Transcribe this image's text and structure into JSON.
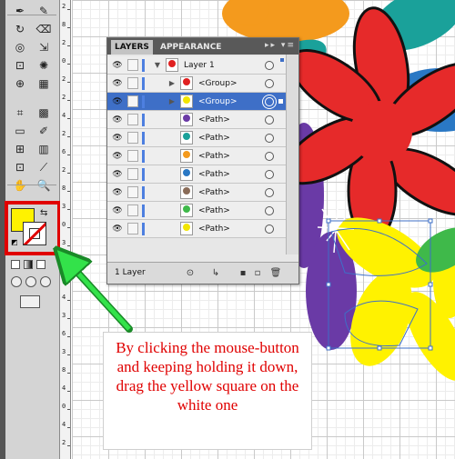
{
  "toolbox": {
    "tools": [
      {
        "name": "pen-icon",
        "glyph": "✒"
      },
      {
        "name": "pencil-icon",
        "glyph": "✎"
      },
      {
        "name": "rotate-icon",
        "glyph": "↻"
      },
      {
        "name": "eraser-icon",
        "glyph": "⌫"
      },
      {
        "name": "warp-icon",
        "glyph": "◎"
      },
      {
        "name": "scale-icon",
        "glyph": "⇲"
      },
      {
        "name": "free-transform-icon",
        "glyph": "⊡"
      },
      {
        "name": "symbol-sprayer-icon",
        "glyph": "✺"
      },
      {
        "name": "shape-builder-icon",
        "glyph": "⊕"
      },
      {
        "name": "live-paint-icon",
        "glyph": "▦"
      },
      {
        "name": "perspective-grid-icon",
        "glyph": "⌗"
      },
      {
        "name": "mesh-icon",
        "glyph": "▩"
      },
      {
        "name": "gradient-icon",
        "glyph": "▭"
      },
      {
        "name": "eyedropper-icon",
        "glyph": "✐"
      },
      {
        "name": "blend-icon",
        "glyph": "⊞"
      },
      {
        "name": "column-graph-icon",
        "glyph": "▥"
      },
      {
        "name": "artboard-icon",
        "glyph": "⊡"
      },
      {
        "name": "slice-icon",
        "glyph": "⟋"
      },
      {
        "name": "hand-icon",
        "glyph": "✋"
      },
      {
        "name": "zoom-icon",
        "glyph": "🔍"
      }
    ],
    "swap_glyph": "⇆",
    "default_glyph": "◩"
  },
  "ruler_numbers": [
    "2",
    "8",
    "2",
    "0",
    "2",
    "2",
    "4",
    "2",
    "6",
    "2",
    "8",
    "3",
    "0",
    "3",
    "2",
    "3",
    "4",
    "3",
    "6",
    "3",
    "8",
    "4",
    "0",
    "4",
    "2"
  ],
  "layers_panel": {
    "tabs": {
      "active": "LAYERS",
      "inactive": "APPEARANCE"
    },
    "menu_glyph": "▸▸ ▾≡",
    "rows": [
      {
        "name": "Layer 1",
        "thumb_color": "#e02020",
        "indent": 0,
        "expander": "▼",
        "selected": false
      },
      {
        "name": "<Group>",
        "thumb_color": "#e02020",
        "indent": 1,
        "expander": "▶",
        "selected": false
      },
      {
        "name": "<Group>",
        "thumb_color": "#f2e500",
        "indent": 1,
        "expander": "▶",
        "selected": true
      },
      {
        "name": "<Path>",
        "thumb_color": "#6a3aa6",
        "indent": 2,
        "expander": "",
        "selected": false
      },
      {
        "name": "<Path>",
        "thumb_color": "#1aa19a",
        "indent": 2,
        "expander": "",
        "selected": false
      },
      {
        "name": "<Path>",
        "thumb_color": "#f49a1d",
        "indent": 2,
        "expander": "",
        "selected": false
      },
      {
        "name": "<Path>",
        "thumb_color": "#2a78c4",
        "indent": 2,
        "expander": "",
        "selected": false
      },
      {
        "name": "<Path>",
        "thumb_color": "#8a6c58",
        "indent": 2,
        "expander": "",
        "selected": false
      },
      {
        "name": "<Path>",
        "thumb_color": "#3fb94a",
        "indent": 2,
        "expander": "",
        "selected": false
      },
      {
        "name": "<Path>",
        "thumb_color": "#f2e500",
        "indent": 2,
        "expander": "",
        "selected": false
      }
    ],
    "footer_label": "1 Layer",
    "footer_icons": [
      "⊙",
      "↳",
      "▪",
      "▫",
      "🗑"
    ]
  },
  "instruction": {
    "text": "By clicking the mouse-button and keeping holding it down, drag the yellow square on the white one"
  },
  "colors": {
    "fill": "#fff200",
    "highlight": "#e00000",
    "arrow": "#33e24a",
    "selection": "#3e6fc7"
  }
}
